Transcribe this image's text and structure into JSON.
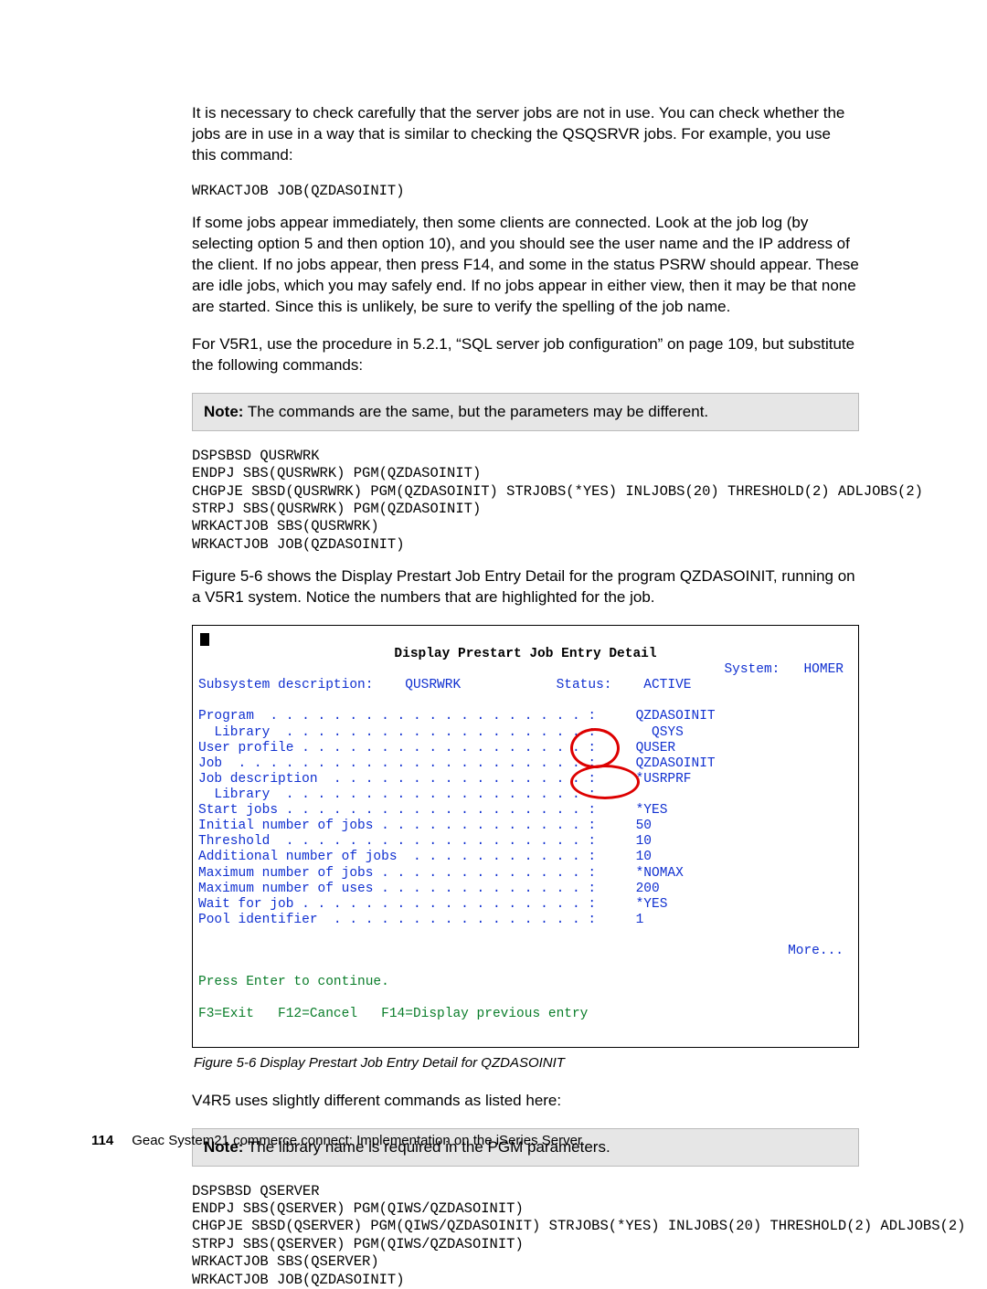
{
  "para1": "It is necessary to check carefully that the server jobs are not in use. You can check whether the jobs are in use in a way that is similar to checking the QSQSRVR jobs. For example, you use this command:",
  "cmd1": "WRKACTJOB JOB(QZDASOINIT)",
  "para2": "If some jobs appear immediately, then some clients are connected. Look at the job log (by selecting option 5 and then option 10), and you should see the user name and the IP address of the client. If no jobs appear, then press F14, and some in the status PSRW should appear. These are idle jobs, which you may safely end. If no jobs appear in either view, then it may be that none are started. Since this is unlikely, be sure to verify the spelling of the job name.",
  "para3": "For V5R1, use the procedure in 5.2.1, “SQL server job configuration” on page 109, but substitute the following commands:",
  "note1_label": "Note:",
  "note1_text": " The commands are the same, but the parameters may be different.",
  "cmdblock1": "DSPSBSD QUSRWRK\nENDPJ SBS(QUSRWRK) PGM(QZDASOINIT)\nCHGPJE SBSD(QUSRWRK) PGM(QZDASOINIT) STRJOBS(*YES) INLJOBS(20) THRESHOLD(2) ADLJOBS(2)\nSTRPJ SBS(QUSRWRK) PGM(QZDASOINIT)\nWRKACTJOB SBS(QUSRWRK)\nWRKACTJOB JOB(QZDASOINIT)",
  "para4": "Figure 5-6 shows the Display Prestart Job Entry Detail for the program QZDASOINIT, running on a V5R1 system. Notice the numbers that are highlighted for the job.",
  "term": {
    "title": "Display Prestart Job Entry Detail",
    "system_lbl": "System:",
    "system_val": "HOMER",
    "line_sub": "Subsystem description:    QUSRWRK            Status:    ACTIVE",
    "rows": [
      {
        "l": "Program  . . . . . . . . . . . . . . . . . . . . :",
        "v": "QZDASOINIT"
      },
      {
        "l": "  Library  . . . . . . . . . . . . . . . . . . . :",
        "v": "  QSYS"
      },
      {
        "l": "User profile . . . . . . . . . . . . . . . . . . :",
        "v": "QUSER"
      },
      {
        "l": "Job  . . . . . . . . . . . . . . . . . . . . . . :",
        "v": "QZDASOINIT"
      },
      {
        "l": "Job description  . . . . . . . . . . . . . . . . :",
        "v": "*USRPRF"
      },
      {
        "l": "  Library  . . . . . . . . . . . . . . . . . . . :",
        "v": ""
      },
      {
        "l": "Start jobs . . . . . . . . . . . . . . . . . . . :",
        "v": "*YES"
      },
      {
        "l": "Initial number of jobs . . . . . . . . . . . . . :",
        "v": "50"
      },
      {
        "l": "Threshold  . . . . . . . . . . . . . . . . . . . :",
        "v": "10"
      },
      {
        "l": "Additional number of jobs  . . . . . . . . . . . :",
        "v": "10"
      },
      {
        "l": "Maximum number of jobs . . . . . . . . . . . . . :",
        "v": "*NOMAX"
      },
      {
        "l": "Maximum number of uses . . . . . . . . . . . . . :",
        "v": "200"
      },
      {
        "l": "Wait for job . . . . . . . . . . . . . . . . . . :",
        "v": "*YES"
      },
      {
        "l": "Pool identifier  . . . . . . . . . . . . . . . . :",
        "v": "1"
      }
    ],
    "more": "More...",
    "press_enter": "Press Enter to continue.",
    "fkeys": "F3=Exit   F12=Cancel   F14=Display previous entry"
  },
  "caption": "Figure 5-6   Display Prestart Job Entry Detail for QZDASOINIT",
  "para5": "V4R5 uses slightly different commands as listed here:",
  "note2_label": "Note:",
  "note2_text": " The library name is required in the PGM parameters.",
  "cmdblock2": "DSPSBSD QSERVER\nENDPJ SBS(QSERVER) PGM(QIWS/QZDASOINIT)\nCHGPJE SBSD(QSERVER) PGM(QIWS/QZDASOINIT) STRJOBS(*YES) INLJOBS(20) THRESHOLD(2) ADLJOBS(2)\nSTRPJ SBS(QSERVER) PGM(QIWS/QZDASOINIT)\nWRKACTJOB SBS(QSERVER)\nWRKACTJOB JOB(QZDASOINIT)",
  "footer_page": "114",
  "footer_text": "Geac System21 commerce.connect: Implementation on the iSeries Server"
}
